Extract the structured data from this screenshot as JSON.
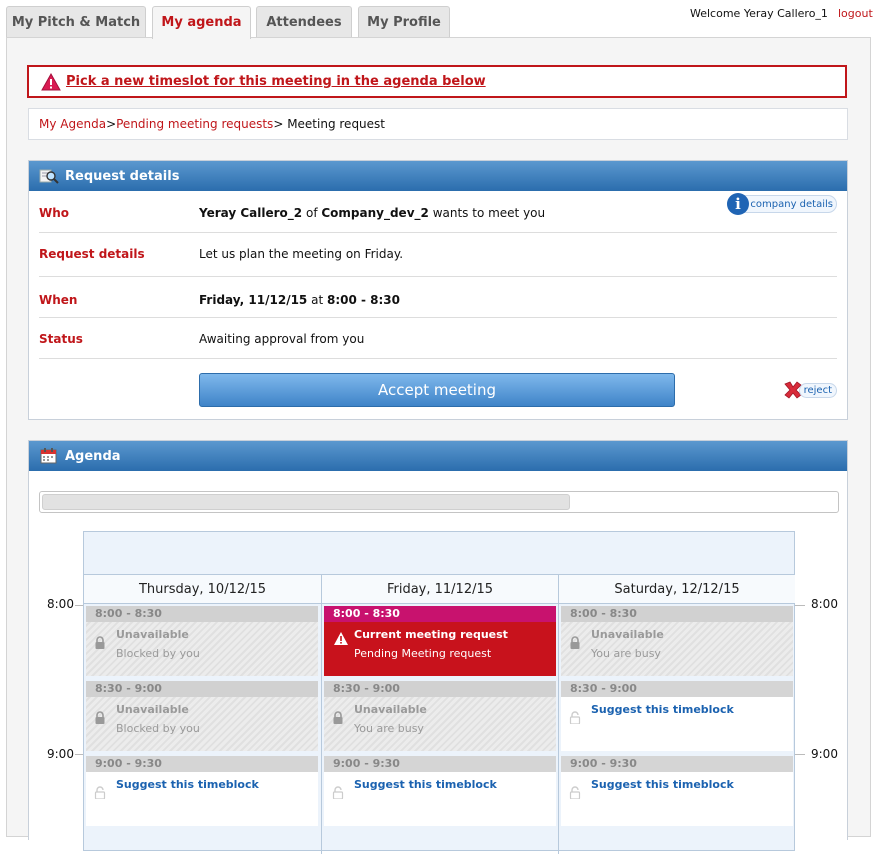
{
  "tabs": [
    {
      "label": "My Pitch & Match"
    },
    {
      "label": "My agenda"
    },
    {
      "label": "Attendees"
    },
    {
      "label": "My Profile"
    }
  ],
  "header": {
    "welcome": "Welcome Yeray Callero_1",
    "logout": "logout"
  },
  "alert": {
    "text": "Pick a new timeslot for this meeting in the agenda below"
  },
  "breadcrumb": {
    "item1": "My Agenda",
    "sep1": ">",
    "item2": "Pending meeting requests",
    "sep2": ">",
    "current": " Meeting request"
  },
  "request": {
    "title": "Request details",
    "who_label": "Who",
    "who_name": "Yeray Callero_2",
    "who_of": " of ",
    "who_company": "Company_dev_2",
    "who_suffix": " wants to meet you",
    "company_details": "company details",
    "details_label": "Request details",
    "details_value": "Let us plan the meeting on Friday.",
    "when_label": "When",
    "when_date": "Friday, 11/12/15",
    "when_at": " at ",
    "when_time": "8:00 - 8:30",
    "status_label": "Status",
    "status_value": "Awaiting approval from you",
    "accept": "Accept meeting",
    "reject": "reject"
  },
  "agenda": {
    "title": "Agenda",
    "times": {
      "t800": "8:00",
      "t900": "9:00"
    },
    "days": [
      {
        "label": "Thursday, 10/12/15"
      },
      {
        "label": "Friday, 11/12/15"
      },
      {
        "label": "Saturday, 12/12/15"
      }
    ],
    "slots": {
      "thu_800": {
        "time": "8:00 - 8:30",
        "title": "Unavailable",
        "sub": "Blocked by you"
      },
      "thu_830": {
        "time": "8:30 - 9:00",
        "title": "Unavailable",
        "sub": "Blocked by you"
      },
      "thu_900": {
        "time": "9:00 - 9:30",
        "action": "Suggest this timeblock"
      },
      "fri_800": {
        "time": "8:00 - 8:30",
        "title": "Current meeting request",
        "sub": "Pending Meeting request"
      },
      "fri_830": {
        "time": "8:30 - 9:00",
        "title": "Unavailable",
        "sub": "You are busy"
      },
      "fri_900": {
        "time": "9:00 - 9:30",
        "action": "Suggest this timeblock"
      },
      "sat_800": {
        "time": "8:00 - 8:30",
        "title": "Unavailable",
        "sub": "You are busy"
      },
      "sat_830": {
        "time": "8:30 - 9:00",
        "action": "Suggest this timeblock"
      },
      "sat_900": {
        "time": "9:00 - 9:30",
        "action": "Suggest this timeblock"
      }
    }
  },
  "colors": {
    "accent_red": "#c0161a",
    "header_blue": "#2b6dad",
    "link_blue": "#1b62b0",
    "current_red": "#c8121c",
    "current_magenta": "#c8126e"
  }
}
